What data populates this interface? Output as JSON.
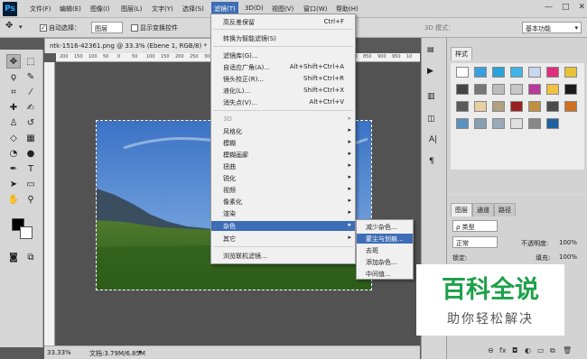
{
  "menubar": {
    "logo": "Ps",
    "items": [
      "文件(F)",
      "编辑(E)",
      "图像(I)",
      "图层(L)",
      "文字(Y)",
      "选择(S)",
      "滤镜(T)",
      "3D(D)",
      "视图(V)",
      "窗口(W)",
      "帮助(H)"
    ],
    "window_controls": [
      "—",
      "□",
      "✕"
    ]
  },
  "options": {
    "auto_select": "自动选择：",
    "layer_select": "图层",
    "show_transform": "显示变换控件",
    "mode_3d": "3D 模式：",
    "workspace": "基本功能"
  },
  "document": {
    "tab": "ntk-1516-42361.png @ 33.3% (Ebene 1, RGB/8) *",
    "ruler_ticks": [
      "200",
      "150",
      "100",
      "50",
      "0",
      "50",
      "100",
      "150",
      "200",
      "250",
      "300",
      "350",
      "400",
      "450",
      "500",
      "550",
      "600",
      "650",
      "700",
      "750",
      "800",
      "850",
      "900",
      "950",
      "10"
    ],
    "zoom": "33.33%",
    "doc_info": "文档:3.79M/6.85M"
  },
  "filter_menu": {
    "top": [
      {
        "label": "高反差保留",
        "shortcut": "Ctrl+F"
      }
    ],
    "smart": [
      {
        "label": "转换为智能滤镜(S)"
      }
    ],
    "main": [
      {
        "label": "滤镜库(G)..."
      },
      {
        "label": "自适应广角(A)...",
        "shortcut": "Alt+Shift+Ctrl+A"
      },
      {
        "label": "镜头校正(R)...",
        "shortcut": "Shift+Ctrl+R"
      },
      {
        "label": "液化(L)...",
        "shortcut": "Shift+Ctrl+X"
      },
      {
        "label": "消失点(V)...",
        "shortcut": "Alt+Ctrl+V"
      }
    ],
    "groups": [
      {
        "label": "3D"
      },
      {
        "label": "风格化"
      },
      {
        "label": "模糊"
      },
      {
        "label": "模糊画廊"
      },
      {
        "label": "扭曲"
      },
      {
        "label": "锐化"
      },
      {
        "label": "视频"
      },
      {
        "label": "像素化"
      },
      {
        "label": "渲染"
      },
      {
        "label": "杂色"
      },
      {
        "label": "其它"
      }
    ],
    "browse": [
      {
        "label": "浏览联机滤镜..."
      }
    ]
  },
  "noise_submenu": {
    "items": [
      "减少杂色...",
      "蒙尘与划痕...",
      "去斑",
      "添加杂色...",
      "中间值..."
    ]
  },
  "right_panel": {
    "swatches_tab": "样式",
    "layers_tabs": [
      "图层",
      "通道",
      "路径"
    ],
    "kind": "ρ 类型",
    "blend": "正常",
    "opacity_label": "不透明度:",
    "opacity": "100%",
    "lock_label": "锁定:",
    "fill_label": "填充:",
    "fill": "100%"
  },
  "watermark": {
    "line1": "百科全说",
    "line2": "助你轻松解决"
  },
  "colors": {
    "menu_highlight": "#3d6db5",
    "watermark_green": "#1da14a"
  }
}
